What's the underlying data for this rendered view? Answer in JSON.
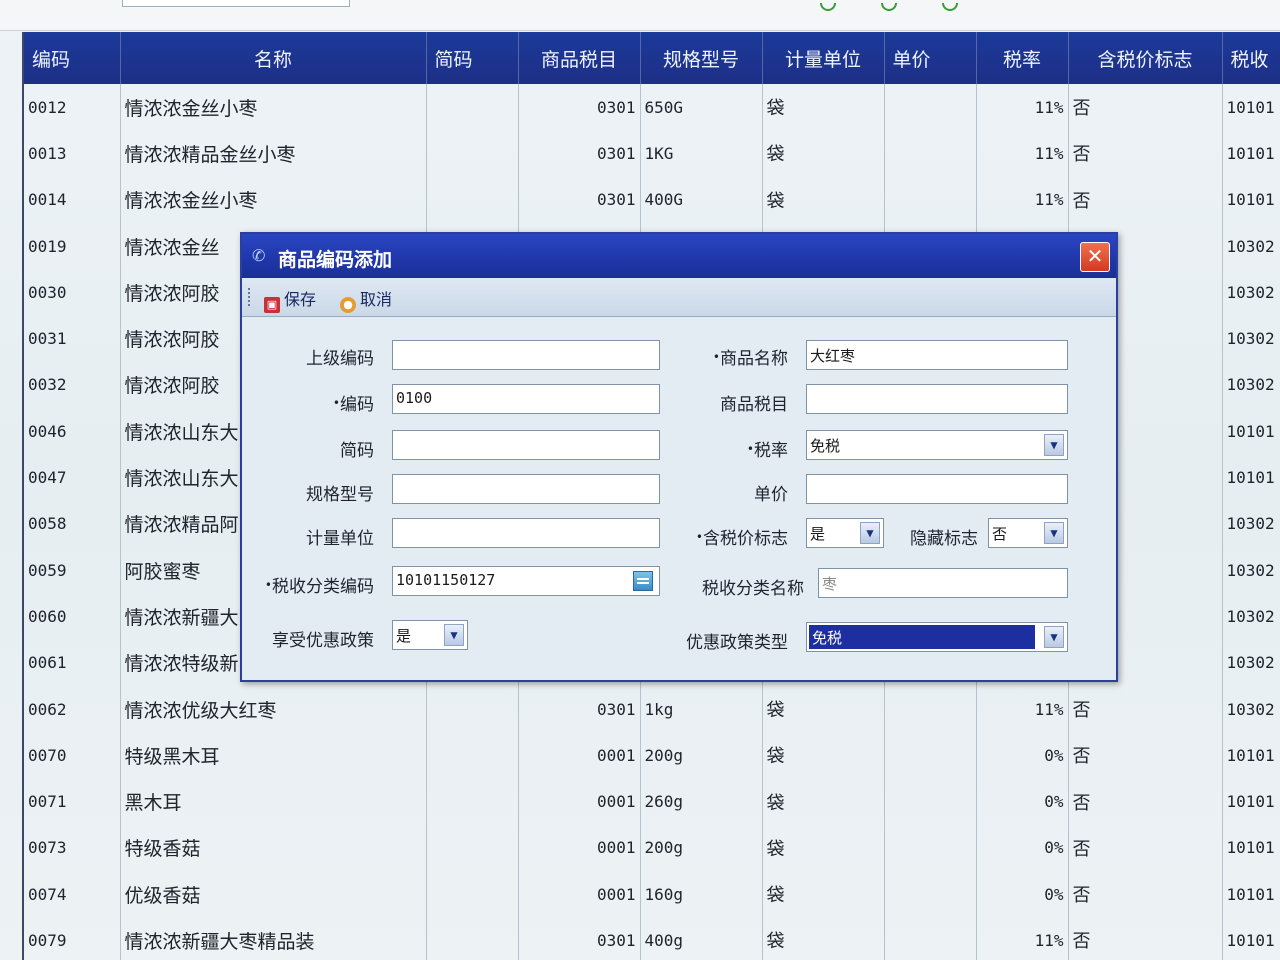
{
  "table": {
    "headers": [
      "编码",
      "名称",
      "简码",
      "商品税目",
      "规格型号",
      "计量单位",
      "单价",
      "税率",
      "含税价标志",
      "税收"
    ],
    "rows": [
      {
        "code": "0012",
        "name": "情浓浓金丝小枣",
        "jianma": "",
        "shuimu": "0301",
        "spec": "650G",
        "unit": "袋",
        "price": "",
        "rate": "11%",
        "flag": "否",
        "tax": "10101"
      },
      {
        "code": "0013",
        "name": "情浓浓精品金丝小枣",
        "jianma": "",
        "shuimu": "0301",
        "spec": "1KG",
        "unit": "袋",
        "price": "",
        "rate": "11%",
        "flag": "否",
        "tax": "10101"
      },
      {
        "code": "0014",
        "name": "情浓浓金丝小枣",
        "jianma": "",
        "shuimu": "0301",
        "spec": "400G",
        "unit": "袋",
        "price": "",
        "rate": "11%",
        "flag": "否",
        "tax": "10101"
      },
      {
        "code": "0019",
        "name": "情浓浓金丝",
        "jianma": "",
        "shuimu": "",
        "spec": "",
        "unit": "",
        "price": "",
        "rate": "",
        "flag": "",
        "tax": "10302"
      },
      {
        "code": "0030",
        "name": "情浓浓阿胶",
        "jianma": "",
        "shuimu": "",
        "spec": "",
        "unit": "",
        "price": "",
        "rate": "",
        "flag": "",
        "tax": "10302"
      },
      {
        "code": "0031",
        "name": "情浓浓阿胶",
        "jianma": "",
        "shuimu": "",
        "spec": "",
        "unit": "",
        "price": "",
        "rate": "",
        "flag": "",
        "tax": "10302"
      },
      {
        "code": "0032",
        "name": "情浓浓阿胶",
        "jianma": "",
        "shuimu": "",
        "spec": "",
        "unit": "",
        "price": "",
        "rate": "",
        "flag": "",
        "tax": "10302"
      },
      {
        "code": "0046",
        "name": "情浓浓山东大",
        "jianma": "",
        "shuimu": "",
        "spec": "",
        "unit": "",
        "price": "",
        "rate": "",
        "flag": "",
        "tax": "10101"
      },
      {
        "code": "0047",
        "name": "情浓浓山东大",
        "jianma": "",
        "shuimu": "",
        "spec": "",
        "unit": "",
        "price": "",
        "rate": "",
        "flag": "",
        "tax": "10101"
      },
      {
        "code": "0058",
        "name": "情浓浓精品阿",
        "jianma": "",
        "shuimu": "",
        "spec": "",
        "unit": "",
        "price": "",
        "rate": "",
        "flag": "",
        "tax": "10302"
      },
      {
        "code": "0059",
        "name": "阿胶蜜枣",
        "jianma": "",
        "shuimu": "",
        "spec": "",
        "unit": "",
        "price": "",
        "rate": "",
        "flag": "",
        "tax": "10302"
      },
      {
        "code": "0060",
        "name": "情浓浓新疆大",
        "jianma": "",
        "shuimu": "",
        "spec": "",
        "unit": "",
        "price": "",
        "rate": "",
        "flag": "",
        "tax": "10302"
      },
      {
        "code": "0061",
        "name": "情浓浓特级新",
        "jianma": "",
        "shuimu": "",
        "spec": "",
        "unit": "",
        "price": "",
        "rate": "",
        "flag": "",
        "tax": "10302"
      },
      {
        "code": "0062",
        "name": "情浓浓优级大红枣",
        "jianma": "",
        "shuimu": "0301",
        "spec": "1kg",
        "unit": "袋",
        "price": "",
        "rate": "11%",
        "flag": "否",
        "tax": "10302"
      },
      {
        "code": "0070",
        "name": "特级黑木耳",
        "jianma": "",
        "shuimu": "0001",
        "spec": "200g",
        "unit": "袋",
        "price": "",
        "rate": "0%",
        "flag": "否",
        "tax": "10101"
      },
      {
        "code": "0071",
        "name": "黑木耳",
        "jianma": "",
        "shuimu": "0001",
        "spec": "260g",
        "unit": "袋",
        "price": "",
        "rate": "0%",
        "flag": "否",
        "tax": "10101"
      },
      {
        "code": "0073",
        "name": "特级香菇",
        "jianma": "",
        "shuimu": "0001",
        "spec": "200g",
        "unit": "袋",
        "price": "",
        "rate": "0%",
        "flag": "否",
        "tax": "10101"
      },
      {
        "code": "0074",
        "name": "优级香菇",
        "jianma": "",
        "shuimu": "0001",
        "spec": "160g",
        "unit": "袋",
        "price": "",
        "rate": "0%",
        "flag": "否",
        "tax": "10101"
      },
      {
        "code": "0079",
        "name": "情浓浓新疆大枣精品装",
        "jianma": "",
        "shuimu": "0301",
        "spec": "400g",
        "unit": "袋",
        "price": "",
        "rate": "11%",
        "flag": "否",
        "tax": "10101"
      }
    ]
  },
  "dialog": {
    "title": "商品编码添加",
    "close_glyph": "✕",
    "toolbar": {
      "save": "保存",
      "cancel": "取消"
    },
    "fields": {
      "parent_code": {
        "label": "上级编码",
        "value": ""
      },
      "code": {
        "label": "编码",
        "value": "0100"
      },
      "jianma": {
        "label": "简码",
        "value": ""
      },
      "spec": {
        "label": "规格型号",
        "value": ""
      },
      "unit": {
        "label": "计量单位",
        "value": ""
      },
      "tax_class_code": {
        "label": "税收分类编码",
        "value": "10101150127"
      },
      "preferential": {
        "label": "享受优惠政策",
        "value": "是"
      },
      "goods_name": {
        "label": "商品名称",
        "value": "大红枣"
      },
      "shuimu": {
        "label": "商品税目",
        "value": ""
      },
      "rate": {
        "label": "税率",
        "value": "免税"
      },
      "price": {
        "label": "单价",
        "value": ""
      },
      "tax_incl_flag": {
        "label": "含税价标志",
        "value": "是"
      },
      "hidden_flag": {
        "label": "隐藏标志",
        "value": "否"
      },
      "tax_class_name": {
        "label": "税收分类名称",
        "value": "枣"
      },
      "policy_type": {
        "label": "优惠政策类型",
        "value": "免税"
      }
    }
  },
  "colors": {
    "header_bg": "#1d2f86",
    "title_bg": "#1f36a8",
    "close_btn": "#d23a20",
    "selection": "#1c2ea0"
  }
}
